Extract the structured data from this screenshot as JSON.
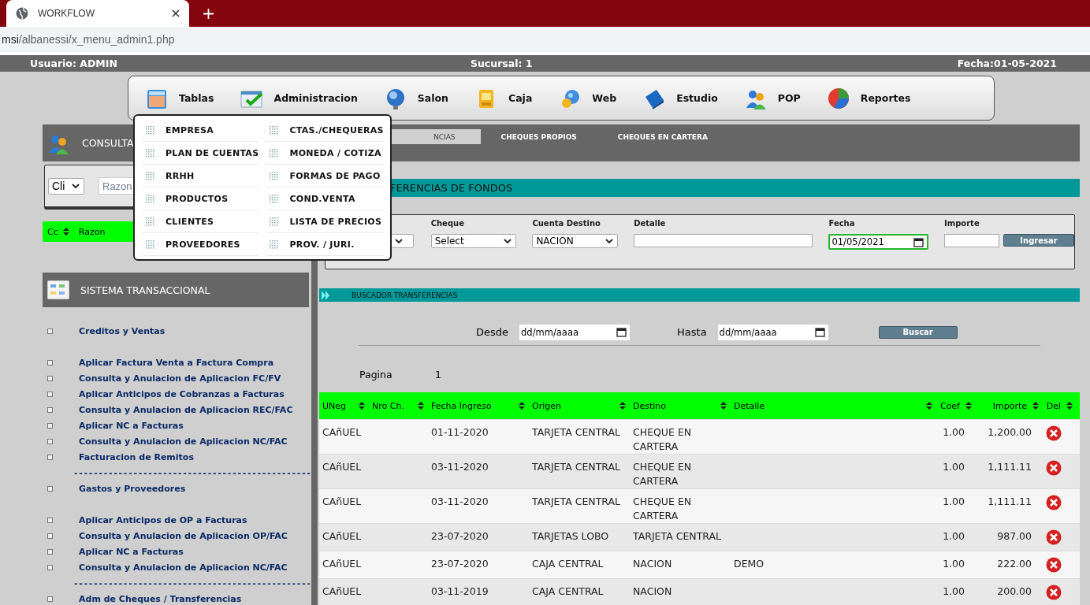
{
  "browser": {
    "tab_title": "WORKFLOW",
    "url_host": "msi",
    "url_path": "/albanessi/x_menu_admin1.php"
  },
  "info_bar": {
    "user": "Usuario: ADMIN",
    "branch": "Sucursal: 1",
    "date": "Fecha:01-05-2021"
  },
  "main_menu": [
    {
      "label": "Tablas"
    },
    {
      "label": "Administracion"
    },
    {
      "label": "Salon"
    },
    {
      "label": "Caja"
    },
    {
      "label": "Web"
    },
    {
      "label": "Estudio"
    },
    {
      "label": "POP"
    },
    {
      "label": "Reportes"
    }
  ],
  "dropdown": {
    "columns": [
      [
        "EMPRESA",
        "PLAN DE CUENTAS",
        "RRHH",
        "PRODUCTOS",
        "CLIENTES",
        "PROVEEDORES"
      ],
      [
        "CTAS./CHEQUERAS",
        "MONEDA / COTIZA",
        "FORMAS DE PAGO",
        "COND.VENTA",
        "LISTA DE PRECIOS",
        "PROV. / JURI."
      ]
    ]
  },
  "consulta": {
    "title": "CONSULTA",
    "type_select": "Cli",
    "search_placeholder": "Razon",
    "columns": [
      "Cc",
      "Razon"
    ]
  },
  "sistema": {
    "title": "SISTEMA TRANSACCIONAL",
    "groups": [
      {
        "title": "Creditos y Ventas",
        "items": [
          "Aplicar Factura Venta a Factura Compra",
          "Consulta y Anulacion de Aplicacion FC/FV",
          "Aplicar Anticipos de Cobranzas a Facturas",
          "Consulta y Anulacion de Aplicacion REC/FAC",
          "Aplicar NC a Facturas",
          "Consulta y Anulacion de Aplicacion NC/FAC",
          "Facturacion de Remitos"
        ],
        "separator": "------------------------------------------------"
      },
      {
        "title": "Gastos y Proveedores",
        "items": [
          "Aplicar Anticipos de OP a Facturas",
          "Consulta y Anulacion de Aplicacion OP/FAC",
          "Aplicar NC a Facturas",
          "Consulta y Anulacion de Aplicacion NC/FAC"
        ],
        "separator": "------------------------------------------------"
      },
      {
        "title": "Adm de Cheques / Transferencias"
      }
    ]
  },
  "tabs": [
    {
      "label": "NCIAS",
      "selected": true
    },
    {
      "label": "CHEQUES PROPIOS",
      "selected": false
    },
    {
      "label": "CHEQUES EN CARTERA",
      "selected": false
    }
  ],
  "section_title": "FERENCIAS DE FONDOS",
  "form": {
    "cheque_label": "Cheque",
    "cheque_value": "Select",
    "cuenta_label": "Cuenta Destino",
    "cuenta_value": "NACION",
    "detalle_label": "Detalle",
    "fecha_label": "Fecha",
    "fecha_value": "01/05/2021",
    "fecha_focused": true,
    "importe_label": "Importe",
    "submit": "Ingresar"
  },
  "search": {
    "title": "BUSCADOR TRANSFERENCIAS",
    "desde_label": "Desde",
    "desde_placeholder": "dd/mm/aaaa",
    "hasta_label": "Hasta",
    "hasta_placeholder": "dd/mm/aaaa",
    "button": "Buscar",
    "page_label": "Pagina",
    "page": "1"
  },
  "table": {
    "columns": [
      "UNeg",
      "Nro Ch.",
      "Fecha Ingreso",
      "Origen",
      "Destino",
      "Detalle",
      "Coef",
      "Importe",
      "Del"
    ],
    "rows": [
      [
        "CAñUEL",
        "",
        "01-11-2020",
        "TARJETA CENTRAL",
        "CHEQUE EN CARTERA",
        "",
        "1.00",
        "1,200.00"
      ],
      [
        "CAñUEL",
        "",
        "03-11-2020",
        "TARJETA CENTRAL",
        "CHEQUE EN CARTERA",
        "",
        "1.00",
        "1,111.11"
      ],
      [
        "CAñUEL",
        "",
        "03-11-2020",
        "TARJETA CENTRAL",
        "CHEQUE EN CARTERA",
        "",
        "1.00",
        "1,111.11"
      ],
      [
        "CAñUEL",
        "",
        "23-07-2020",
        "TARJETAS LOBO",
        "TARJETA CENTRAL",
        "",
        "1.00",
        "987.00"
      ],
      [
        "CAñUEL",
        "",
        "23-07-2020",
        "CAJA CENTRAL",
        "NACION",
        "DEMO",
        "1.00",
        "222.00"
      ],
      [
        "CAñUEL",
        "",
        "03-11-2019",
        "CAJA CENTRAL",
        "NACION",
        "",
        "1.00",
        "200.00"
      ]
    ]
  }
}
